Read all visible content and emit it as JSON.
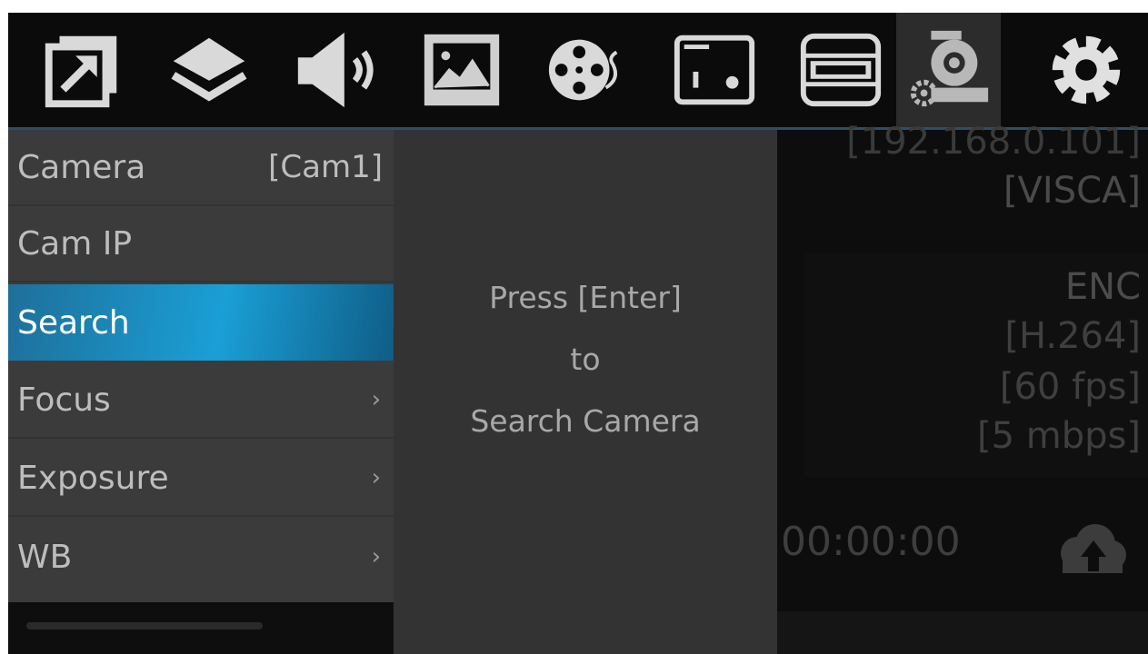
{
  "toolbar": {
    "icons": [
      {
        "name": "output-window-icon"
      },
      {
        "name": "layers-icon"
      },
      {
        "name": "audio-icon"
      },
      {
        "name": "image-icon"
      },
      {
        "name": "media-reel-icon"
      },
      {
        "name": "display-panel-icon"
      },
      {
        "name": "hdmi-icon"
      },
      {
        "name": "ptz-camera-settings-icon",
        "active": true
      },
      {
        "name": "gear-icon"
      }
    ],
    "accent_line_color": "#2f4d6a"
  },
  "menu": {
    "items": [
      {
        "label": "Camera",
        "value": "[Cam1]"
      },
      {
        "label": "Cam IP"
      },
      {
        "label": "Search",
        "selected": true
      },
      {
        "label": "Focus",
        "chevron": "›"
      },
      {
        "label": "Exposure",
        "chevron": "›"
      },
      {
        "label": "WB",
        "chevron": "›"
      }
    ],
    "selected_color": "#1a9fd6"
  },
  "center": {
    "line1": "Press [Enter]",
    "line2": "to",
    "line3": "Search Camera"
  },
  "status": {
    "ip": "[192.168.0.101]",
    "protocol": "[VISCA]",
    "enc_label": "ENC",
    "codec": "[H.264]",
    "fps": "[60 fps]",
    "bitrate": "[5 mbps]",
    "timer": "00:00:00",
    "upload_icon": "cloud-upload-icon"
  }
}
